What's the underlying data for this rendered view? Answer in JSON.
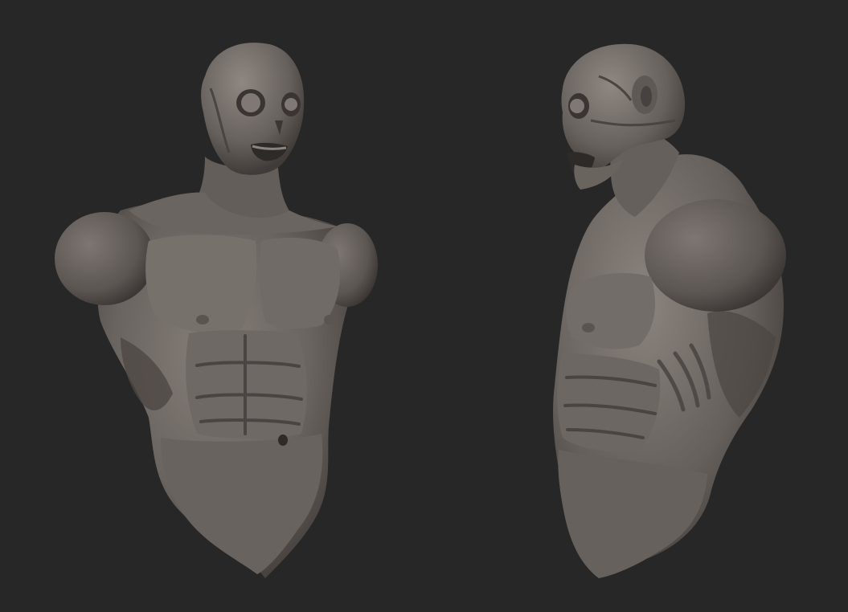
{
  "scene": {
    "background_color": "#272727",
    "clay_color": "#6e6864",
    "clay_shadow_color": "#3f3a37",
    "clay_highlight_color": "#8c8580",
    "views": [
      {
        "name": "front-three-quarter"
      },
      {
        "name": "side-profile"
      }
    ]
  }
}
